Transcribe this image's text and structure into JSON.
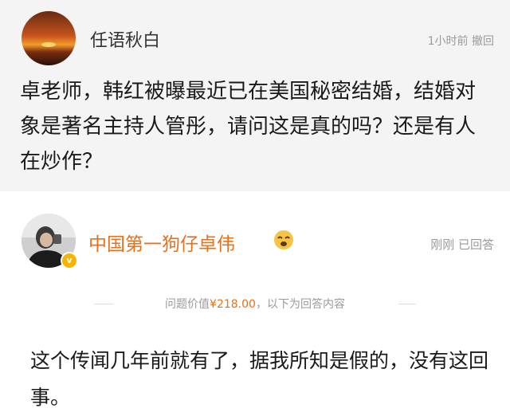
{
  "question": {
    "asker_name": "任语秋白",
    "meta": "1小时前 撤回",
    "text": "卓老师，韩红被曝最近已在美国秘密结婚，结婚对象是著名主持人管彤，请问这是真的吗？还是有人在炒作？"
  },
  "answer": {
    "answerer_name": "中国第一狗仔卓伟",
    "meta": "刚刚 已回答",
    "price_prefix": "问题价值",
    "price_value": "¥218.00",
    "price_suffix": "，以下为回答内容",
    "text": "这个传闻几年前就有了，据我所知是假的，没有这回事。"
  },
  "icons": {
    "asker_avatar": "sunset-avatar",
    "answerer_avatar": "person-avatar",
    "badge": "verified-badge-icon",
    "emoji": "emoji-icon"
  },
  "colors": {
    "accent": "#e8701a",
    "question_bg": "#f4f4f4",
    "meta_text": "#9a9a9a",
    "verify_badge": "#f7b500"
  }
}
